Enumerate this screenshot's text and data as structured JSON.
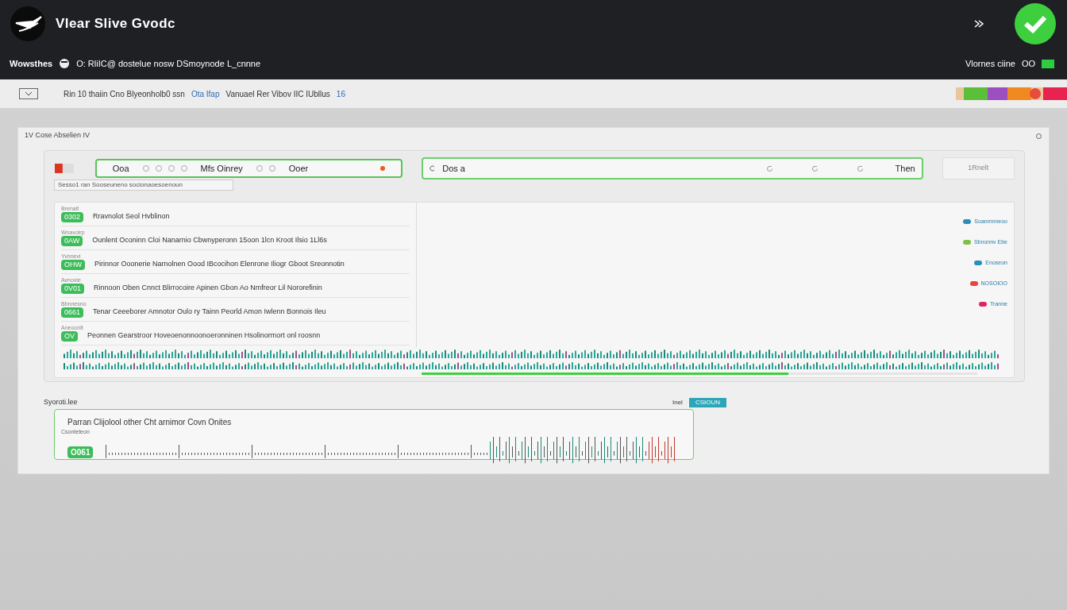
{
  "header": {
    "title": "Vlear Slive Gvodc",
    "status_label": "Wowsthes",
    "status_text": "O: RliIC@ dostelue nosw DSmoynode L_cnnne",
    "right_label": "Vlornes ciine",
    "right_value": "OO",
    "online": true
  },
  "toolbar": {
    "text": "Rin 10 thaiin Cno Blyeonholb0 ssn",
    "link": "Ota Ifap",
    "text_2": "Vanuael Rer Vibov IIC IUbllus",
    "count": "16"
  },
  "panel": {
    "title": "1V Cose Abselien IV",
    "search_1": {
      "value": "Ooa",
      "middle": "Mfs Oinrey",
      "end": "Ooer"
    },
    "search_2": {
      "value": "Dos a",
      "end": "Then"
    },
    "side_button": "1Rnelt",
    "hint": "Sesso1 ran Sooseuneno socionaoesoenoun",
    "rows": [
      {
        "tag": "Brenalt",
        "badge": "0302",
        "text": "Rravnolot Seol Hvblinon"
      },
      {
        "tag": "Wnavolrp",
        "badge": "0AW",
        "text": "Ounlent Oconinn Cloi Nanarnio Cbwnyperonn 15oon 1lcn Kroot Ilsio 1Ll6s"
      },
      {
        "tag": "Yvnnevi",
        "badge": "OHW",
        "text": "Pirinnor Ooonerie Narnolnen Oood IBcocihon Elenrone Iliogr Gboot Sreonnotin"
      },
      {
        "tag": "Avnovle",
        "badge": "0V01",
        "text": "Rinnoon Oben Cnnct Blirrocoire Apinen Gbon Ao Nmfreor Lil Nororefinin"
      },
      {
        "tag": "Bbnnesno",
        "badge": "0661",
        "text": "Tenar Ceeeborer Amnotor Oulo ry Tainn Peorld Amon Iwlenn Bonnois Ileu"
      },
      {
        "tag": "Aneoonlt",
        "badge": "OV",
        "text": "Peonnen Gearstroor Hoveoenonnoonoeronninen Hsolinormort onl roosnn"
      }
    ],
    "legend": [
      {
        "label": "Soanmnneoo",
        "color": "#2a8fb8"
      },
      {
        "label": "Sbnonnv Ebe",
        "color": "#7cc242"
      },
      {
        "label": "Enoseon",
        "color": "#2a8fb8"
      },
      {
        "label": "NOSOIOO",
        "color": "#e8453c"
      },
      {
        "label": "Tranne",
        "color": "#e0245e"
      }
    ],
    "progress": {
      "level": 0.66
    }
  },
  "bottom": {
    "title": "Syoroti.lee",
    "tab": "Inel",
    "tab_2": "CSIOUN",
    "card_text": "Parran Clijolool other Cht arnimor Covn Onites",
    "caption": "Csonteteon",
    "badge": "O061"
  }
}
